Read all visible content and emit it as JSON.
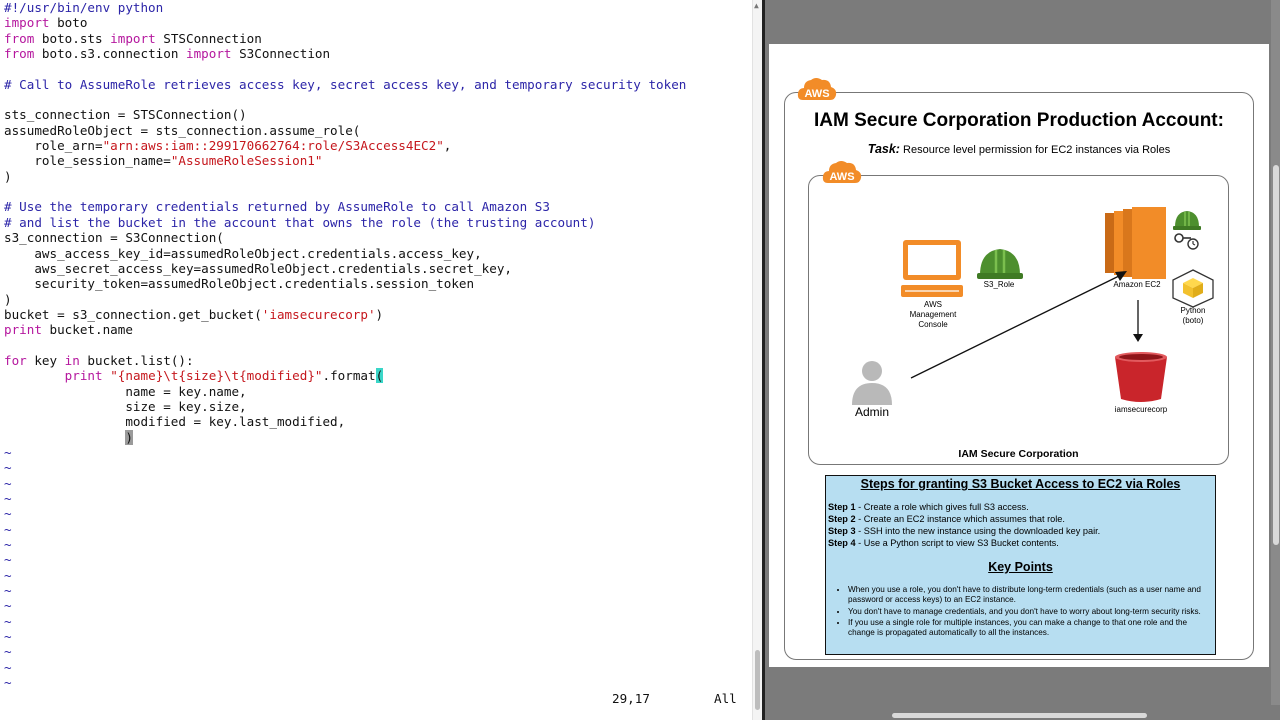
{
  "editor": {
    "lines": [
      [
        [
          "sh",
          "#!/usr/bin/env python"
        ]
      ],
      [
        [
          "kw",
          "import"
        ],
        [
          "",
          " boto"
        ]
      ],
      [
        [
          "kw",
          "from"
        ],
        [
          "",
          " boto.sts "
        ],
        [
          "kw",
          "import"
        ],
        [
          "",
          " STSConnection"
        ]
      ],
      [
        [
          "kw",
          "from"
        ],
        [
          "",
          " boto.s3.connection "
        ],
        [
          "kw",
          "import"
        ],
        [
          "",
          " S3Connection"
        ]
      ],
      [
        [
          "",
          ""
        ]
      ],
      [
        [
          "cm",
          "# Call to AssumeRole retrieves access key, secret access key, and temporary security token"
        ]
      ],
      [
        [
          "",
          ""
        ]
      ],
      [
        [
          "",
          "sts_connection = STSConnection()"
        ]
      ],
      [
        [
          "",
          "assumedRoleObject = sts_connection.assume_role("
        ]
      ],
      [
        [
          "",
          "    role_arn="
        ],
        [
          "st",
          "\"arn:aws:iam::299170662764:role/S3Access4EC2\""
        ],
        [
          "",
          ","
        ]
      ],
      [
        [
          "",
          "    role_session_name="
        ],
        [
          "st",
          "\"AssumeRoleSession1\""
        ]
      ],
      [
        [
          "",
          ")"
        ]
      ],
      [
        [
          "",
          ""
        ]
      ],
      [
        [
          "cm",
          "# Use the temporary credentials returned by AssumeRole to call Amazon S3"
        ]
      ],
      [
        [
          "cm",
          "# and list the bucket in the account that owns the role (the trusting account)"
        ]
      ],
      [
        [
          "",
          "s3_connection = S3Connection("
        ]
      ],
      [
        [
          "",
          "    aws_access_key_id=assumedRoleObject.credentials.access_key,"
        ]
      ],
      [
        [
          "",
          "    aws_secret_access_key=assumedRoleObject.credentials.secret_key,"
        ]
      ],
      [
        [
          "",
          "    security_token=assumedRoleObject.credentials.session_token"
        ]
      ],
      [
        [
          "",
          ")"
        ]
      ],
      [
        [
          "",
          "bucket = s3_connection.get_bucket("
        ],
        [
          "st",
          "'iamsecurecorp'"
        ],
        [
          "",
          ")"
        ]
      ],
      [
        [
          "pr",
          "print"
        ],
        [
          "",
          " bucket.name"
        ]
      ],
      [
        [
          "",
          ""
        ]
      ],
      [
        [
          "kw",
          "for"
        ],
        [
          "",
          " key "
        ],
        [
          "kw",
          "in"
        ],
        [
          "",
          " bucket.list():"
        ]
      ],
      [
        [
          "",
          "        "
        ],
        [
          "pr",
          "print"
        ],
        [
          "",
          " "
        ],
        [
          "st",
          "\""
        ],
        [
          "fmt",
          "{name}\\t{size}\\t{modified}"
        ],
        [
          "st",
          "\""
        ],
        [
          "",
          ".format"
        ],
        [
          "cur-open",
          "("
        ]
      ],
      [
        [
          "",
          "                name = key.name,"
        ]
      ],
      [
        [
          "",
          "                size = key.size,"
        ]
      ],
      [
        [
          "",
          "                modified = key.last_modified,"
        ]
      ],
      [
        [
          "",
          "                "
        ],
        [
          "cur-close",
          ")"
        ]
      ]
    ],
    "tilde": "~",
    "tilde_count": 16,
    "status_position": "29,17",
    "status_scroll": "All"
  },
  "slide": {
    "aws_badge": "AWS",
    "title": "IAM Secure Corporation Production Account:",
    "task_label": "Task:",
    "task_text": " Resource level permission for EC2 instances via Roles",
    "console_label": "AWS\nManagement\nConsole",
    "role_label": "S3_Role",
    "admin_label": "Admin",
    "ec2_label": "Amazon EC2",
    "python_label": "Python\n(boto)",
    "bucket_label": "iamsecurecorp",
    "corp_label": "IAM Secure Corporation",
    "steps_title": "Steps for granting S3 Bucket Access to EC2 via Roles",
    "steps": [
      {
        "label": "Step 1",
        "text": " - Create a role which gives full S3 access."
      },
      {
        "label": "Step 2",
        "text": " - Create an EC2 instance which assumes that role."
      },
      {
        "label": "Step 3",
        "text": " - SSH into the new instance using the downloaded key pair."
      },
      {
        "label": "Step 4",
        "text": " - Use a Python script to view S3 Bucket contents."
      }
    ],
    "key_points_title": "Key Points",
    "key_points": [
      "When you use a role, you don't have to distribute long-term credentials (such as a user name and password or access keys) to an EC2 instance.",
      "You don't have to manage credentials, and you don't have to worry about long-term security risks.",
      "If you use a single role for multiple instances, you can make a change to that one role and the change is propagated automatically to all the instances."
    ]
  },
  "colors": {
    "aws_orange": "#f28c28",
    "helmet_green": "#4d8f2e",
    "bucket_red": "#c9252b",
    "steps_bg": "#b7def1"
  },
  "icons": [
    "monitor-icon",
    "helmet-icon",
    "admin-user-icon",
    "ec2-icon",
    "key-icon",
    "python-cube-icon",
    "s3-bucket-icon",
    "arrow-icon"
  ]
}
